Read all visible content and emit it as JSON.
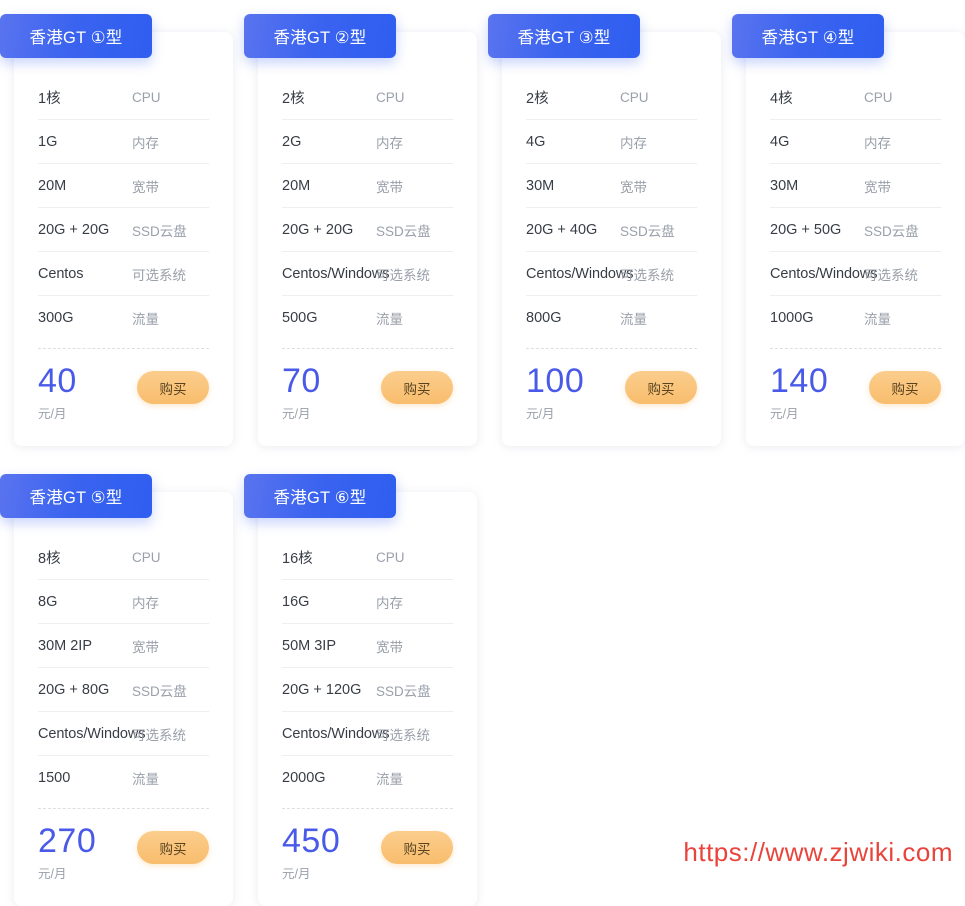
{
  "watermark": "https://www.zjwiki.com",
  "labels": {
    "cpu": "CPU",
    "memory": "内存",
    "bandwidth": "宽带",
    "disk": "SSD云盘",
    "os": "可选系统",
    "traffic": "流量",
    "price_unit": "元/月",
    "buy": "购买"
  },
  "plans": [
    {
      "title": "香港GT ①型",
      "cpu": "1核",
      "memory": "1G",
      "bandwidth": "20M",
      "disk": "20G + 20G",
      "os": "Centos",
      "traffic": "300G",
      "price": "40"
    },
    {
      "title": "香港GT ②型",
      "cpu": "2核",
      "memory": "2G",
      "bandwidth": "20M",
      "disk": "20G + 20G",
      "os": "Centos/Windows",
      "traffic": "500G",
      "price": "70"
    },
    {
      "title": "香港GT ③型",
      "cpu": "2核",
      "memory": "4G",
      "bandwidth": "30M",
      "disk": "20G + 40G",
      "os": "Centos/Windows",
      "traffic": "800G",
      "price": "100"
    },
    {
      "title": "香港GT ④型",
      "cpu": "4核",
      "memory": "4G",
      "bandwidth": "30M",
      "disk": "20G + 50G",
      "os": "Centos/Windows",
      "traffic": "1000G",
      "price": "140"
    },
    {
      "title": "香港GT ⑤型",
      "cpu": "8核",
      "memory": "8G",
      "bandwidth": "30M 2IP",
      "disk": "20G + 80G",
      "os": "Centos/Windows",
      "traffic": "1500",
      "price": "270"
    },
    {
      "title": "香港GT ⑥型",
      "cpu": "16核",
      "memory": "16G",
      "bandwidth": "50M 3IP",
      "disk": "20G + 120G",
      "os": "Centos/Windows",
      "traffic": "2000G",
      "price": "450"
    }
  ],
  "colors": {
    "header_gradient_start": "#5a74ef",
    "header_gradient_end": "#2f5ef0",
    "price": "#4a5ae8",
    "buy_button": "#f8bd6d",
    "watermark": "#e8443c"
  }
}
